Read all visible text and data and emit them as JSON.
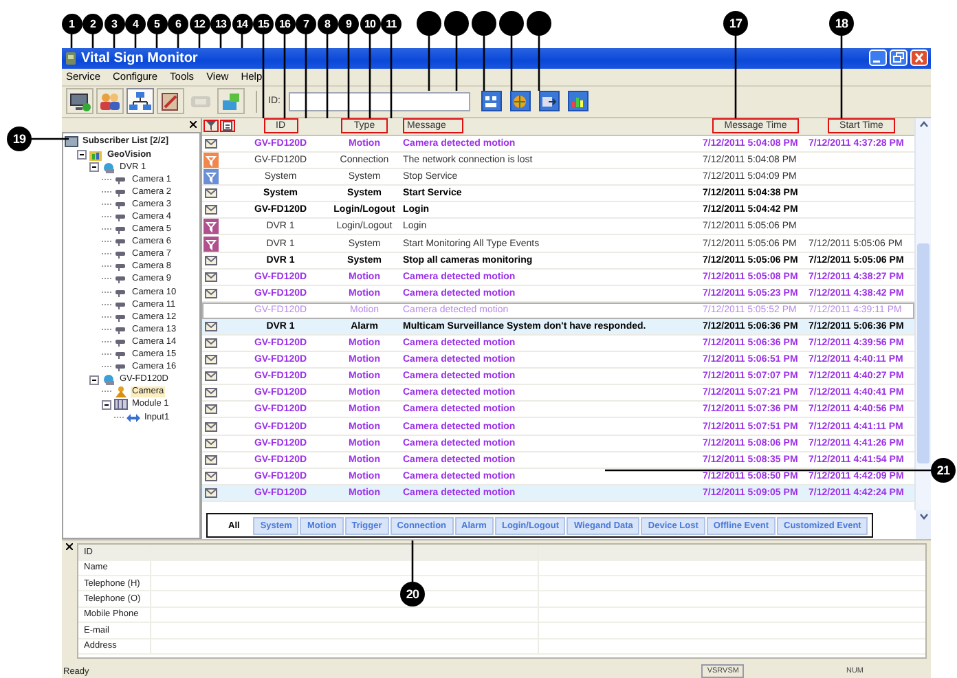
{
  "callouts": [
    {
      "kind": "numbered",
      "label": "1"
    },
    {
      "kind": "numbered",
      "label": "2"
    },
    {
      "kind": "numbered",
      "label": "3"
    },
    {
      "kind": "numbered",
      "label": "4"
    },
    {
      "kind": "numbered",
      "label": "5"
    },
    {
      "kind": "numbered",
      "label": "6"
    },
    {
      "kind": "numbered",
      "label": "12"
    },
    {
      "kind": "numbered",
      "label": "13"
    },
    {
      "kind": "numbered",
      "label": "14"
    },
    {
      "kind": "numbered",
      "label": "15"
    },
    {
      "kind": "numbered",
      "label": "16"
    },
    {
      "kind": "numbered",
      "label": "7"
    },
    {
      "kind": "numbered",
      "label": "8"
    },
    {
      "kind": "numbered",
      "label": "9"
    },
    {
      "kind": "numbered",
      "label": "10"
    },
    {
      "kind": "numbered",
      "label": "11"
    },
    {
      "kind": "blank"
    },
    {
      "kind": "blank"
    },
    {
      "kind": "blank"
    },
    {
      "kind": "blank"
    },
    {
      "kind": "blank"
    },
    {
      "kind": "numbered",
      "label": "17"
    },
    {
      "kind": "numbered",
      "label": "18"
    },
    {
      "kind": "numbered",
      "label": "19"
    },
    {
      "kind": "numbered",
      "label": "20"
    },
    {
      "kind": "numbered",
      "label": "21"
    }
  ],
  "window": {
    "title": "Vital Sign Monitor"
  },
  "menu": [
    "Service",
    "Configure",
    "Tools",
    "View",
    "Help"
  ],
  "toolbar": {
    "buttons": [
      {
        "pressed": false,
        "disabled": false
      },
      {
        "pressed": false,
        "disabled": false
      },
      {
        "pressed": true,
        "disabled": false
      },
      {
        "pressed": false,
        "disabled": false
      },
      {
        "pressed": false,
        "disabled": true
      },
      {
        "pressed": false,
        "disabled": false
      }
    ],
    "id_label": "ID:"
  },
  "tree": {
    "label": "Subscriber List [2/2]",
    "kind": "root",
    "selected": false,
    "children": [
      {
        "label": "GeoVision",
        "kind": "group",
        "expanded": true,
        "selected": false,
        "children": [
          {
            "label": "DVR 1",
            "kind": "dvr",
            "expanded": true,
            "selected": false,
            "children": [
              {
                "label": "Camera 1",
                "kind": "camera",
                "selected": false
              },
              {
                "label": "Camera 2",
                "kind": "camera",
                "selected": false
              },
              {
                "label": "Camera 3",
                "kind": "camera",
                "selected": false
              },
              {
                "label": "Camera 4",
                "kind": "camera",
                "selected": false
              },
              {
                "label": "Camera 5",
                "kind": "camera",
                "selected": false
              },
              {
                "label": "Camera 6",
                "kind": "camera",
                "selected": false
              },
              {
                "label": "Camera 7",
                "kind": "camera",
                "selected": false
              },
              {
                "label": "Camera 8",
                "kind": "camera",
                "selected": false
              },
              {
                "label": "Camera 9",
                "kind": "camera",
                "selected": false
              },
              {
                "label": "Camera 10",
                "kind": "camera",
                "selected": false
              },
              {
                "label": "Camera 11",
                "kind": "camera",
                "selected": false
              },
              {
                "label": "Camera 12",
                "kind": "camera",
                "selected": false
              },
              {
                "label": "Camera 13",
                "kind": "camera",
                "selected": false
              },
              {
                "label": "Camera 14",
                "kind": "camera",
                "selected": false
              },
              {
                "label": "Camera 15",
                "kind": "camera",
                "selected": false
              },
              {
                "label": "Camera 16",
                "kind": "camera",
                "selected": false
              }
            ]
          },
          {
            "label": "GV-FD120D",
            "kind": "dvr",
            "expanded": true,
            "selected": false,
            "children": [
              {
                "label": "Camera",
                "kind": "person",
                "selected": true
              },
              {
                "label": "Module 1",
                "kind": "module",
                "expanded": true,
                "selected": false,
                "children": [
                  {
                    "label": "Input1",
                    "kind": "input",
                    "selected": false
                  }
                ]
              }
            ]
          }
        ]
      }
    ]
  },
  "table": {
    "columns": [
      {
        "kind": "icon",
        "outlined": true
      },
      {
        "kind": "icon",
        "outlined": true
      },
      {
        "kind": "text",
        "label": "ID",
        "outlined": true
      },
      {
        "kind": "text",
        "label": "Type",
        "outlined": true
      },
      {
        "kind": "text",
        "label": "Message",
        "outlined": true
      },
      {
        "kind": "text",
        "label": "Message Time",
        "outlined": true
      },
      {
        "kind": "text",
        "label": "Start Time",
        "outlined": true
      }
    ],
    "rows": [
      {
        "kind": "motion",
        "read": false,
        "id": "GV-FD120D",
        "type": "Motion",
        "message": "Camera detected motion",
        "message_time": "7/12/2011 5:04:08 PM",
        "start_time": "7/12/2011 4:37:28 PM",
        "selected": false,
        "focused": false
      },
      {
        "kind": "event",
        "read": true,
        "color": "#f2874e",
        "id": "GV-FD120D",
        "type": "Connection",
        "message": "The network connection is lost",
        "message_time": "7/12/2011 5:04:08 PM",
        "selected": false,
        "focused": false
      },
      {
        "kind": "event",
        "read": true,
        "color": "#6b8fd6",
        "id": "System",
        "type": "System",
        "message": "Stop Service",
        "message_time": "7/12/2011 5:04:09 PM",
        "selected": false,
        "focused": false
      },
      {
        "kind": "event",
        "read": false,
        "id": "System",
        "type": "System",
        "message": "Start Service",
        "message_time": "7/12/2011 5:04:38 PM",
        "selected": false,
        "focused": false
      },
      {
        "kind": "event",
        "read": false,
        "id": "GV-FD120D",
        "type": "Login/Logout",
        "message": "Login",
        "message_time": "7/12/2011 5:04:42 PM",
        "selected": false,
        "focused": false
      },
      {
        "kind": "event",
        "read": true,
        "color": "#b0508e",
        "id": "DVR 1",
        "type": "Login/Logout",
        "message": "Login",
        "message_time": "7/12/2011 5:05:06 PM",
        "selected": false,
        "focused": false
      },
      {
        "kind": "event",
        "read": true,
        "color": "#b0508e",
        "id": "DVR 1",
        "type": "System",
        "message": "Start Monitoring All Type Events",
        "message_time": "7/12/2011 5:05:06 PM",
        "start_time": "7/12/2011 5:05:06 PM",
        "selected": false,
        "focused": false
      },
      {
        "kind": "event",
        "read": false,
        "id": "DVR 1",
        "type": "System",
        "message": "Stop all cameras monitoring",
        "message_time": "7/12/2011 5:05:06 PM",
        "start_time": "7/12/2011 5:05:06 PM",
        "selected": false,
        "focused": false
      },
      {
        "kind": "motion",
        "read": false,
        "id": "GV-FD120D",
        "type": "Motion",
        "message": "Camera detected motion",
        "message_time": "7/12/2011 5:05:08 PM",
        "start_time": "7/12/2011 4:38:27 PM",
        "selected": false,
        "focused": false
      },
      {
        "kind": "motion",
        "read": false,
        "id": "GV-FD120D",
        "type": "Motion",
        "message": "Camera detected motion",
        "message_time": "7/12/2011 5:05:23 PM",
        "start_time": "7/12/2011 4:38:42 PM",
        "selected": false,
        "focused": false
      },
      {
        "kind": "motion",
        "read": true,
        "id": "GV-FD120D",
        "type": "Motion",
        "message": "Camera detected motion",
        "message_time": "7/12/2011 5:05:52 PM",
        "start_time": "7/12/2011 4:39:11 PM",
        "selected": false,
        "focused": true
      },
      {
        "kind": "event",
        "read": false,
        "id": "DVR 1",
        "type": "Alarm",
        "message": "Multicam Surveillance System don't have responded.",
        "message_time": "7/12/2011 5:06:36 PM",
        "start_time": "7/12/2011 5:06:36 PM",
        "selected": true,
        "focused": false
      },
      {
        "kind": "motion",
        "read": false,
        "id": "GV-FD120D",
        "type": "Motion",
        "message": "Camera detected motion",
        "message_time": "7/12/2011 5:06:36 PM",
        "start_time": "7/12/2011 4:39:56 PM",
        "selected": false,
        "focused": false
      },
      {
        "kind": "motion",
        "read": false,
        "id": "GV-FD120D",
        "type": "Motion",
        "message": "Camera detected motion",
        "message_time": "7/12/2011 5:06:51 PM",
        "start_time": "7/12/2011 4:40:11 PM",
        "selected": false,
        "focused": false
      },
      {
        "kind": "motion",
        "read": false,
        "id": "GV-FD120D",
        "type": "Motion",
        "message": "Camera detected motion",
        "message_time": "7/12/2011 5:07:07 PM",
        "start_time": "7/12/2011 4:40:27 PM",
        "selected": false,
        "focused": false
      },
      {
        "kind": "motion",
        "read": false,
        "id": "GV-FD120D",
        "type": "Motion",
        "message": "Camera detected motion",
        "message_time": "7/12/2011 5:07:21 PM",
        "start_time": "7/12/2011 4:40:41 PM",
        "selected": false,
        "focused": false
      },
      {
        "kind": "motion",
        "read": false,
        "id": "GV-FD120D",
        "type": "Motion",
        "message": "Camera detected motion",
        "message_time": "7/12/2011 5:07:36 PM",
        "start_time": "7/12/2011 4:40:56 PM",
        "selected": false,
        "focused": false
      },
      {
        "kind": "motion",
        "read": false,
        "id": "GV-FD120D",
        "type": "Motion",
        "message": "Camera detected motion",
        "message_time": "7/12/2011 5:07:51 PM",
        "start_time": "7/12/2011 4:41:11 PM",
        "selected": false,
        "focused": false
      },
      {
        "kind": "motion",
        "read": false,
        "id": "GV-FD120D",
        "type": "Motion",
        "message": "Camera detected motion",
        "message_time": "7/12/2011 5:08:06 PM",
        "start_time": "7/12/2011 4:41:26 PM",
        "selected": false,
        "focused": false
      },
      {
        "kind": "motion",
        "read": false,
        "id": "GV-FD120D",
        "type": "Motion",
        "message": "Camera detected motion",
        "message_time": "7/12/2011 5:08:35 PM",
        "start_time": "7/12/2011 4:41:54 PM",
        "selected": false,
        "focused": false
      },
      {
        "kind": "motion",
        "read": false,
        "id": "GV-FD120D",
        "type": "Motion",
        "message": "Camera detected motion",
        "message_time": "7/12/2011 5:08:50 PM",
        "start_time": "7/12/2011 4:42:09 PM",
        "selected": false,
        "focused": false
      },
      {
        "kind": "motion",
        "read": false,
        "id": "GV-FD120D",
        "type": "Motion",
        "message": "Camera detected motion",
        "message_time": "7/12/2011 5:09:05 PM",
        "start_time": "7/12/2011 4:42:24 PM",
        "selected": true,
        "focused": false
      }
    ]
  },
  "filter_tabs": [
    {
      "label": "All",
      "selected": true
    },
    {
      "label": "System",
      "selected": false
    },
    {
      "label": "Motion",
      "selected": false
    },
    {
      "label": "Trigger",
      "selected": false
    },
    {
      "label": "Connection",
      "selected": false
    },
    {
      "label": "Alarm",
      "selected": false
    },
    {
      "label": "Login/Logout",
      "selected": false
    },
    {
      "label": "Wiegand Data",
      "selected": false
    },
    {
      "label": "Device Lost",
      "selected": false
    },
    {
      "label": "Offline Event",
      "selected": false
    },
    {
      "label": "Customized Event",
      "selected": false
    }
  ],
  "details": {
    "fields": [
      "ID",
      "Name",
      "Telephone (H)",
      "Telephone (O)",
      "Mobile Phone",
      "E-mail",
      "Address"
    ]
  },
  "status_bar": {
    "text": "Ready",
    "panels": [
      "VSRVSM",
      "NUM"
    ]
  }
}
